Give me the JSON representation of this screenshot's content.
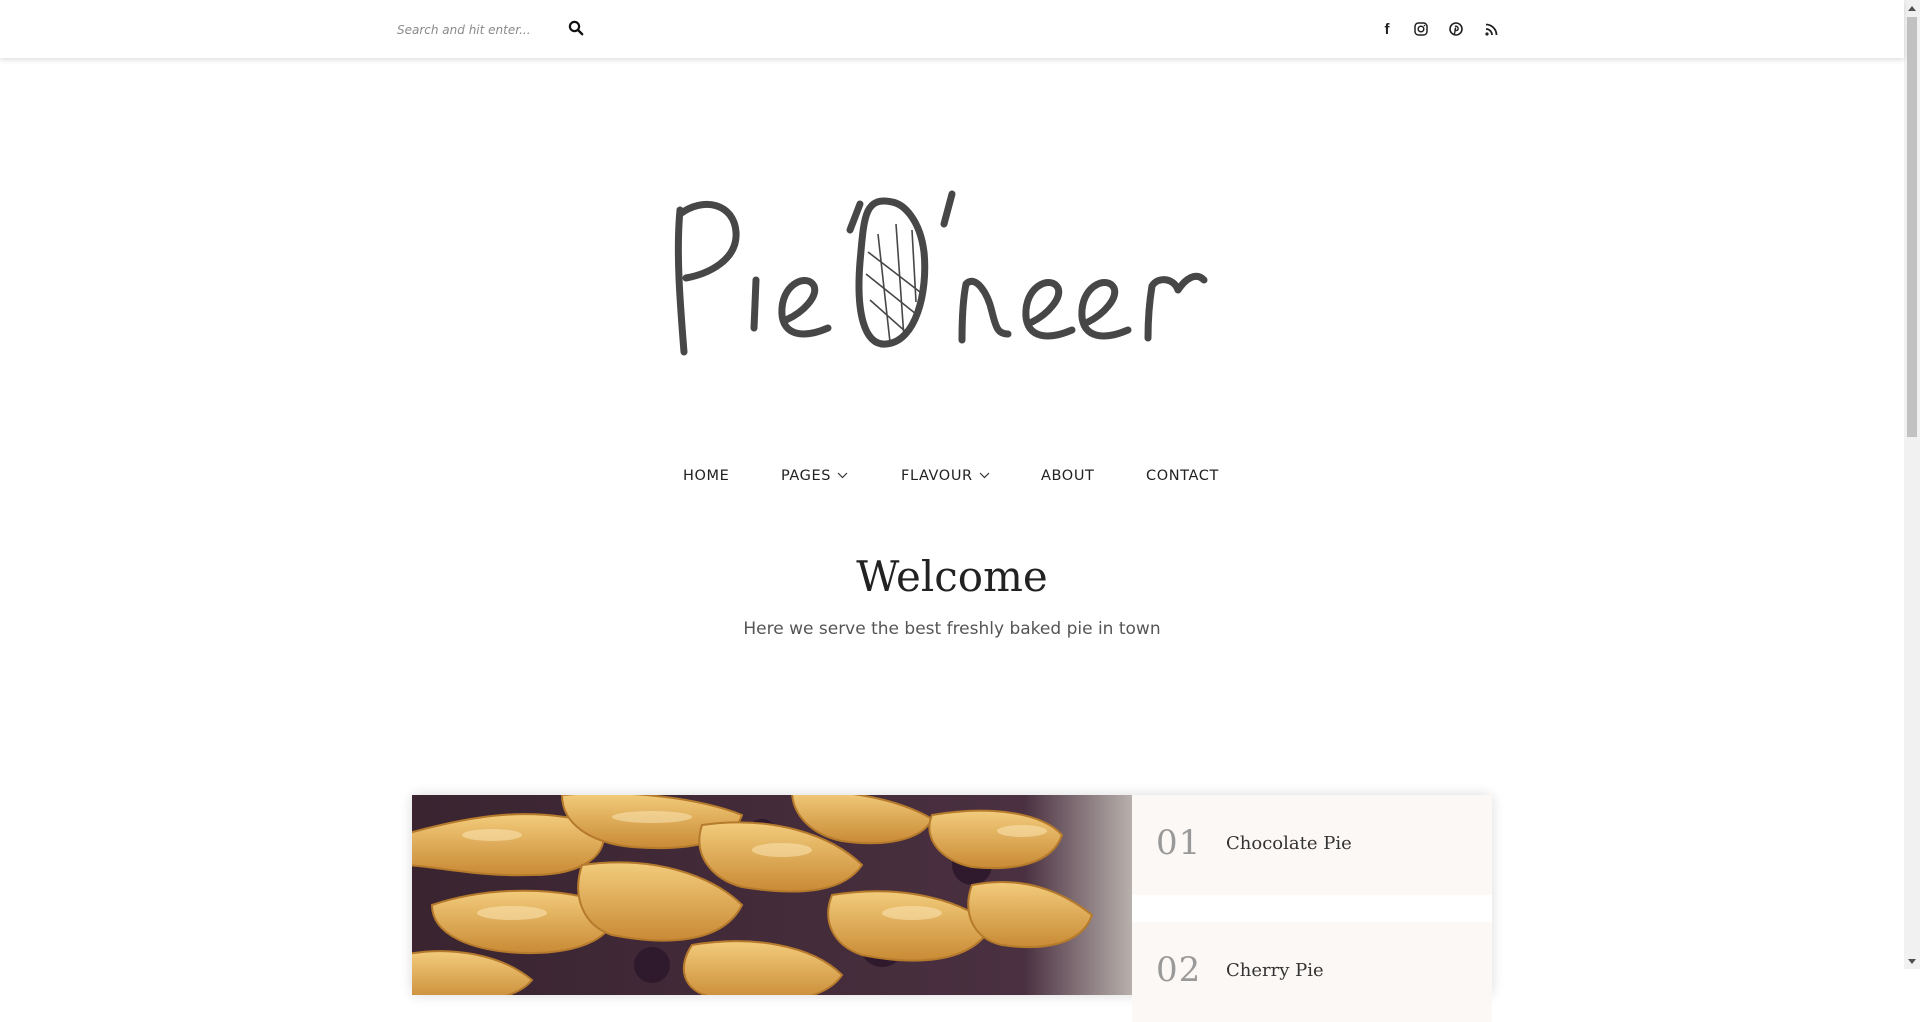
{
  "search": {
    "placeholder": "Search and hit enter..."
  },
  "social": {
    "icons": [
      "facebook-icon",
      "instagram-icon",
      "pinterest-icon",
      "rss-icon"
    ]
  },
  "logo": {
    "text": "Pie'O'neer"
  },
  "nav": {
    "items": [
      {
        "label": "HOME",
        "has_dropdown": false
      },
      {
        "label": "PAGES",
        "has_dropdown": true
      },
      {
        "label": "FLAVOUR",
        "has_dropdown": true
      },
      {
        "label": "ABOUT",
        "has_dropdown": false
      },
      {
        "label": "CONTACT",
        "has_dropdown": false
      }
    ]
  },
  "welcome": {
    "title": "Welcome",
    "subtitle": "Here we serve the best freshly baked pie in town"
  },
  "featured": {
    "items": [
      {
        "number": "01",
        "title": "Chocolate Pie"
      },
      {
        "number": "02",
        "title": "Cherry Pie"
      }
    ]
  },
  "colors": {
    "text_dark": "#222222",
    "logo": "#474747",
    "list_bg": "#fbf8f6",
    "number_gray": "#999999"
  }
}
